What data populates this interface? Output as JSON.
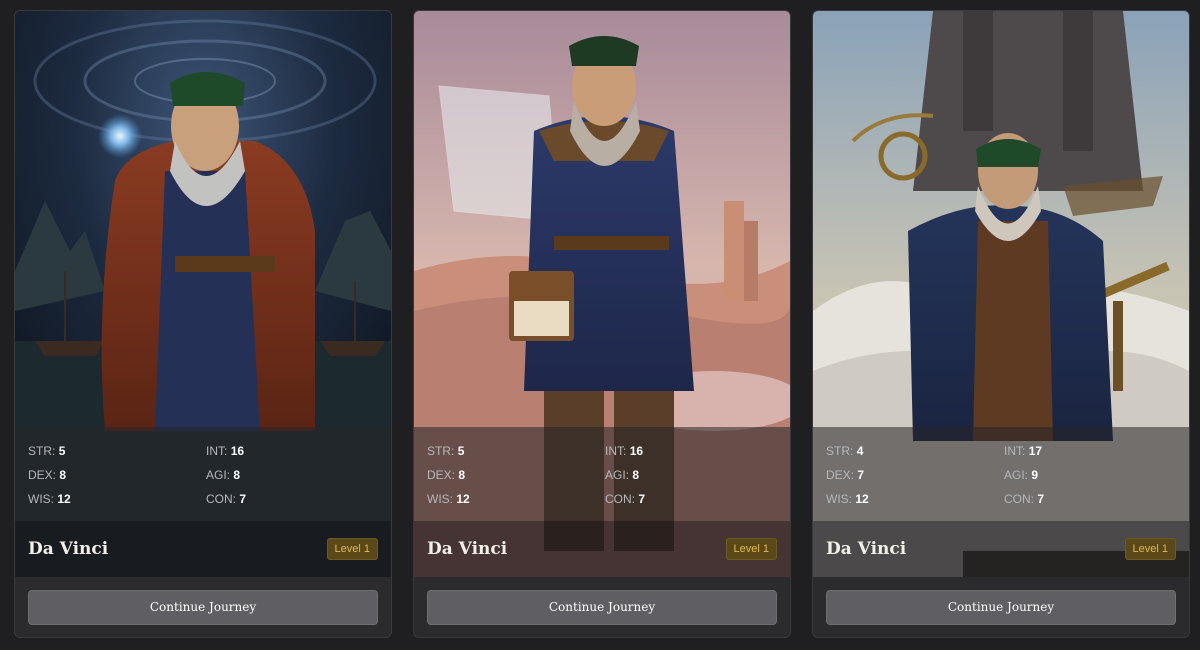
{
  "cards": [
    {
      "name": "Da Vinci",
      "level": "Level 1",
      "portrait_icon": "cosmic-inventor-portrait",
      "stats": [
        {
          "key": "STR:",
          "value": "5"
        },
        {
          "key": "INT:",
          "value": "16"
        },
        {
          "key": "DEX:",
          "value": "8"
        },
        {
          "key": "AGI:",
          "value": "8"
        },
        {
          "key": "WIS:",
          "value": "12"
        },
        {
          "key": "CON:",
          "value": "7"
        }
      ],
      "action": "Continue Journey"
    },
    {
      "name": "Da Vinci",
      "level": "Level 1",
      "portrait_icon": "desert-engineer-portrait",
      "stats": [
        {
          "key": "STR:",
          "value": "5"
        },
        {
          "key": "INT:",
          "value": "16"
        },
        {
          "key": "DEX:",
          "value": "8"
        },
        {
          "key": "AGI:",
          "value": "8"
        },
        {
          "key": "WIS:",
          "value": "12"
        },
        {
          "key": "CON:",
          "value": "7"
        }
      ],
      "action": "Continue Journey"
    },
    {
      "name": "Da Vinci",
      "level": "Level 1",
      "portrait_icon": "sky-castle-astronomer-portrait",
      "stats": [
        {
          "key": "STR:",
          "value": "4"
        },
        {
          "key": "INT:",
          "value": "17"
        },
        {
          "key": "DEX:",
          "value": "7"
        },
        {
          "key": "AGI:",
          "value": "9"
        },
        {
          "key": "WIS:",
          "value": "12"
        },
        {
          "key": "CON:",
          "value": "7"
        }
      ],
      "action": "Continue Journey"
    }
  ],
  "colors": {
    "page_bg": "#1f1f21",
    "card_bg": "#2b2b2e",
    "level_badge_bg": "#5a4818",
    "level_badge_text": "#e0b94a",
    "button_bg": "#5f5f63"
  }
}
